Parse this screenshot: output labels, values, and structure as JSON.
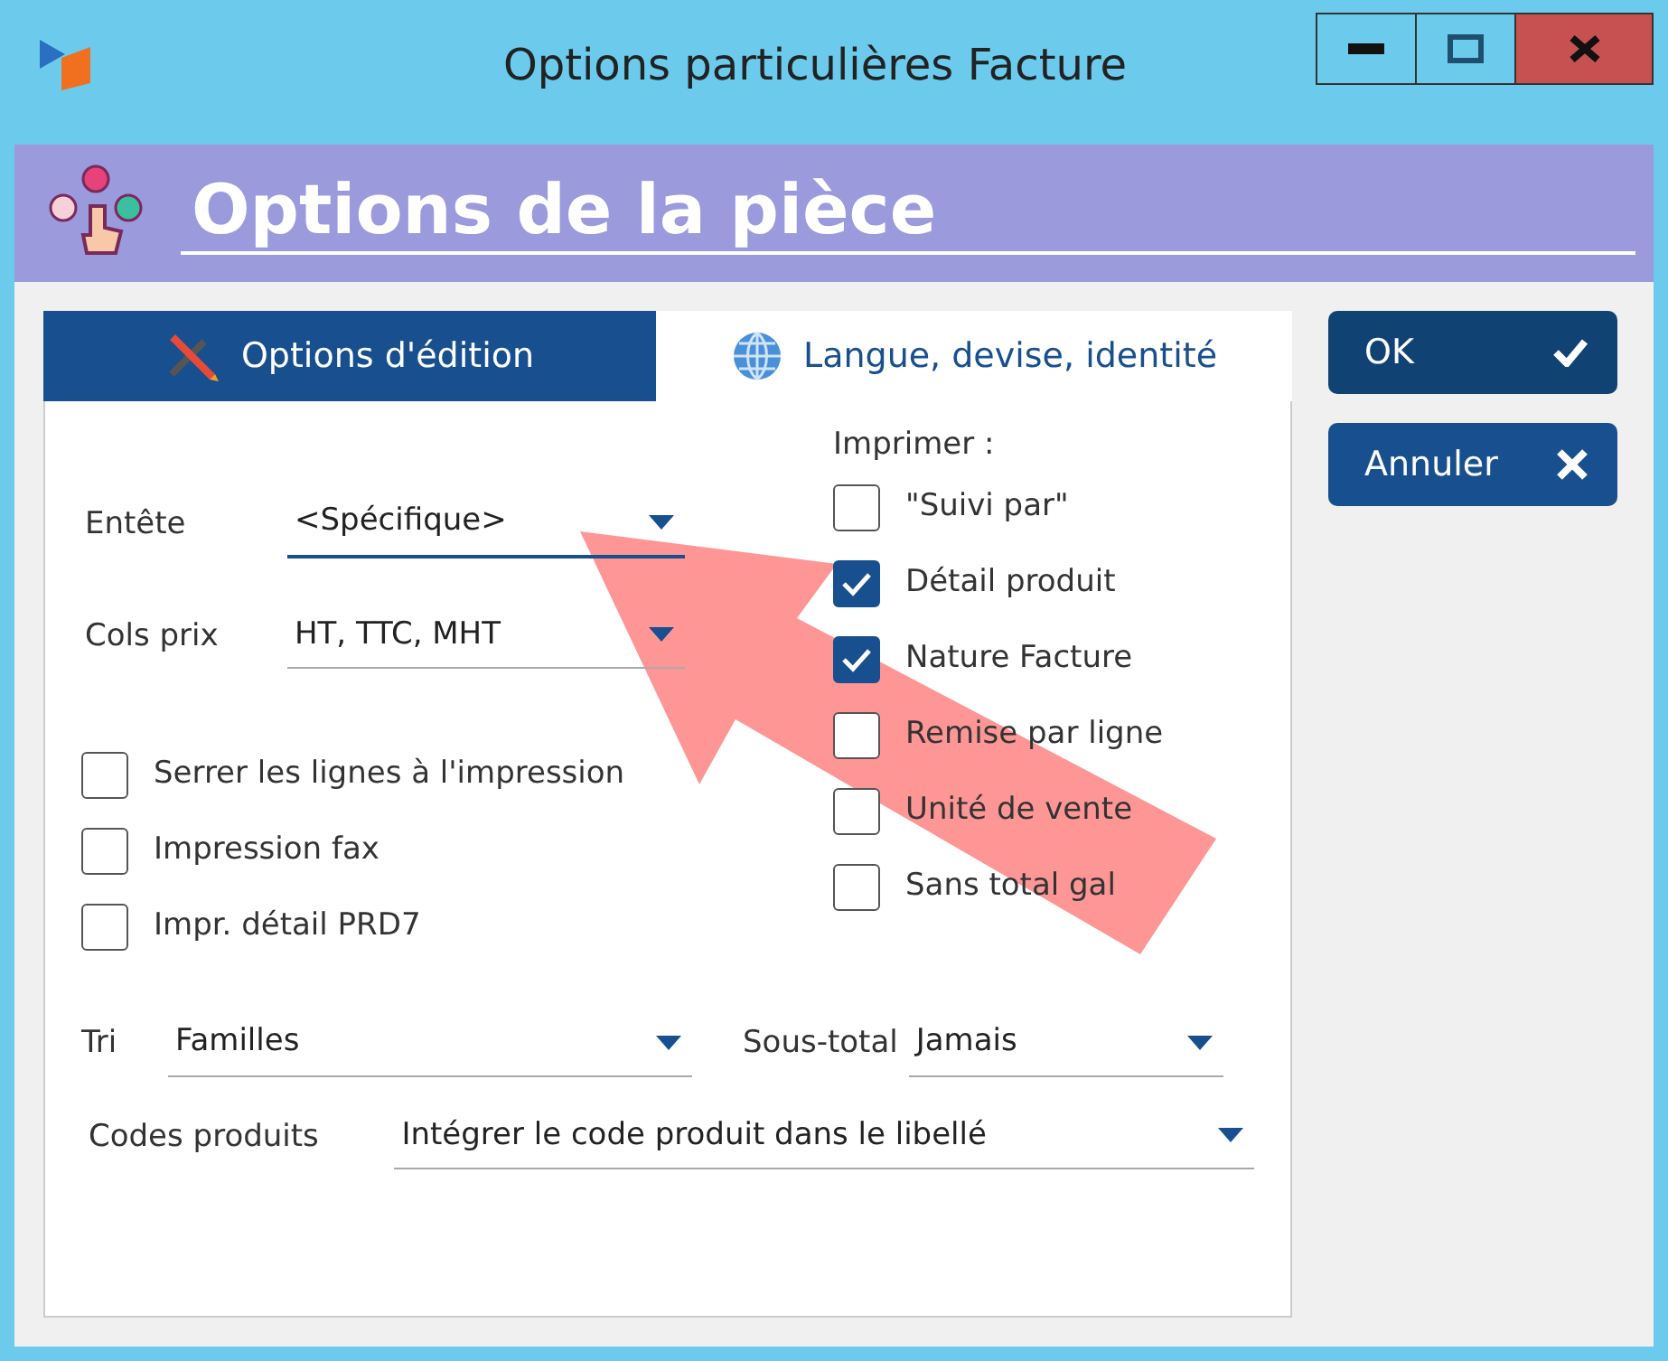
{
  "window": {
    "title": "Options particulières Facture"
  },
  "header": {
    "title": "Options de la pièce"
  },
  "tabs": [
    {
      "label": "Options d'édition",
      "selected": true
    },
    {
      "label": "Langue, devise, identité",
      "selected": false
    }
  ],
  "fields": [
    {
      "label": "Entête",
      "value": "<Spécifique>",
      "focused": true
    },
    {
      "label": "Cols prix",
      "value": "HT, TTC, MHT",
      "focused": false
    }
  ],
  "left_options": [
    {
      "label": "Serrer les lignes à l'impression",
      "checked": false
    },
    {
      "label": "Impression fax",
      "checked": false
    },
    {
      "label": "Impr. détail PRD7",
      "checked": false
    }
  ],
  "print_options": {
    "title": "Imprimer :",
    "items": [
      {
        "label": "\"Suivi par\"",
        "checked": false
      },
      {
        "label": "Détail produit",
        "checked": true
      },
      {
        "label": "Nature Facture",
        "checked": true
      },
      {
        "label": "Remise par ligne",
        "checked": false
      },
      {
        "label": "Unité de vente",
        "checked": false
      },
      {
        "label": "Sans total gal",
        "checked": false
      }
    ]
  },
  "sort": {
    "label": "Tri",
    "value": "Familles"
  },
  "subtotal": {
    "label": "Sous-total",
    "value": "Jamais"
  },
  "product_codes": {
    "label": "Codes produits",
    "value": "Intégrer le code produit dans le libellé"
  },
  "buttons": [
    {
      "label": "OK",
      "kind": "ok"
    },
    {
      "label": "Annuler",
      "kind": "cancel"
    }
  ]
}
